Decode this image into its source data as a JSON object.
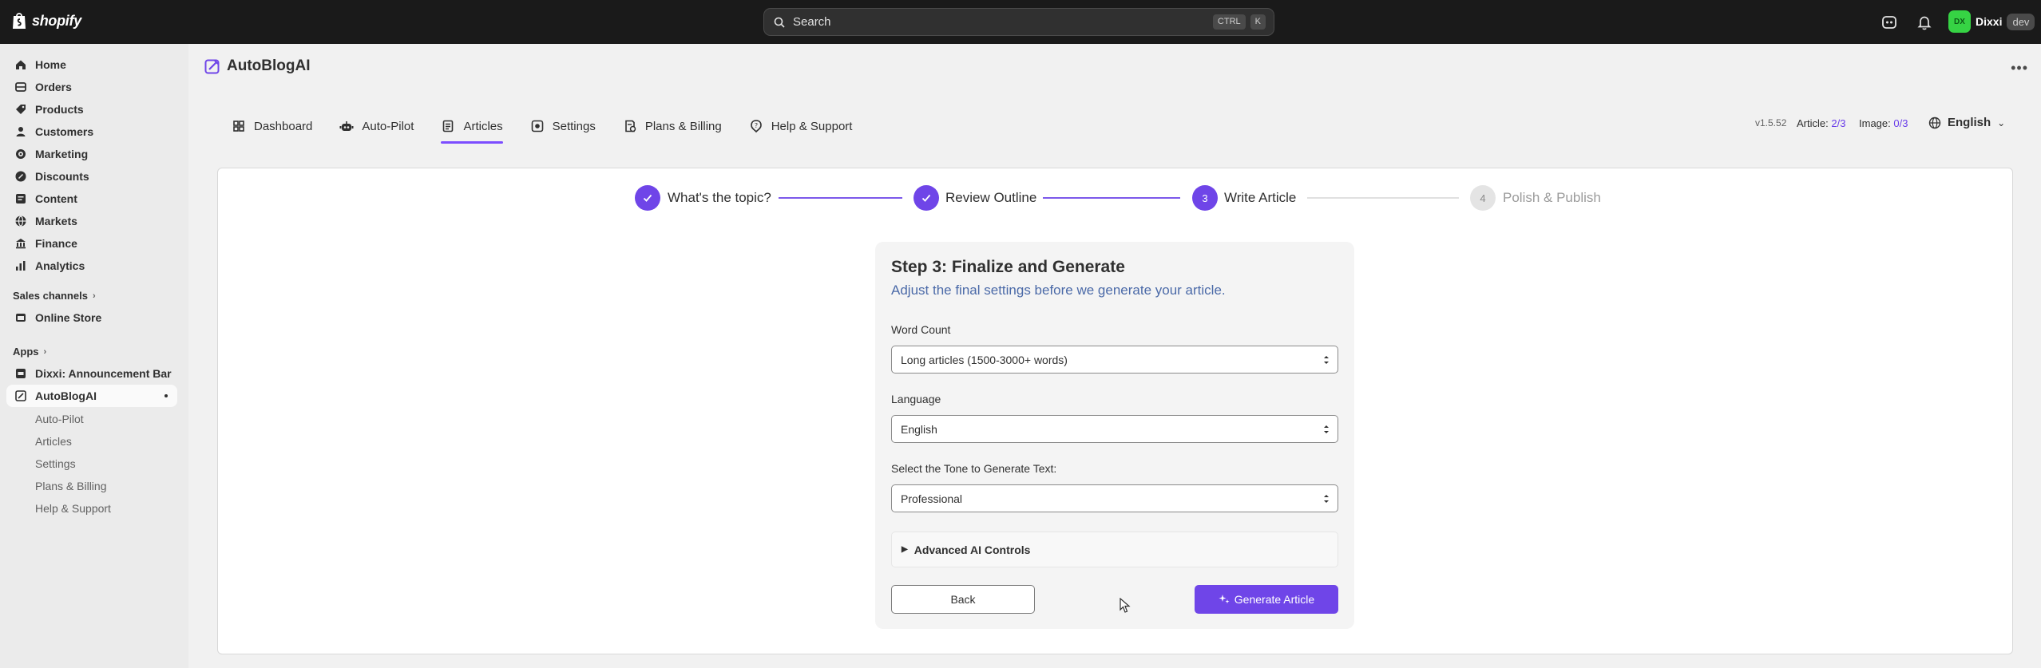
{
  "topbar": {
    "logo_text": "shopify",
    "search_label": "Search",
    "shortcut_keys": [
      "CTRL",
      "K"
    ],
    "user_initials": "DX",
    "user_name": "Dixxi",
    "env_badge": "dev"
  },
  "sidebar": {
    "nav": [
      {
        "label": "Home",
        "icon": "home-icon"
      },
      {
        "label": "Orders",
        "icon": "orders-icon"
      },
      {
        "label": "Products",
        "icon": "tag-icon"
      },
      {
        "label": "Customers",
        "icon": "person-icon"
      },
      {
        "label": "Marketing",
        "icon": "target-icon"
      },
      {
        "label": "Discounts",
        "icon": "discount-icon"
      },
      {
        "label": "Content",
        "icon": "content-icon"
      },
      {
        "label": "Markets",
        "icon": "globe-icon"
      },
      {
        "label": "Finance",
        "icon": "bank-icon"
      },
      {
        "label": "Analytics",
        "icon": "chart-icon"
      }
    ],
    "sales_channels_title": "Sales channels",
    "online_store": "Online Store",
    "apps_title": "Apps",
    "apps": [
      {
        "label": "Dixxi: Announcement Bar"
      },
      {
        "label": "AutoBlogAI"
      }
    ],
    "sub_items": [
      "Auto-Pilot",
      "Articles",
      "Settings",
      "Plans & Billing",
      "Help & Support"
    ]
  },
  "app_header": {
    "title": "AutoBlogAI"
  },
  "tabs": [
    {
      "label": "Dashboard",
      "icon": "dashboard-icon"
    },
    {
      "label": "Auto-Pilot",
      "icon": "robot-icon"
    },
    {
      "label": "Articles",
      "icon": "document-icon",
      "active": true
    },
    {
      "label": "Settings",
      "icon": "settings-icon"
    },
    {
      "label": "Plans & Billing",
      "icon": "billing-icon"
    },
    {
      "label": "Help & Support",
      "icon": "help-icon"
    }
  ],
  "meta": {
    "version": "v1.5.52",
    "article_label": "Article:",
    "article_count": "2/3",
    "image_label": "Image:",
    "image_count": "0/3",
    "language": "English"
  },
  "steps": [
    {
      "number": "1",
      "label": "What's the topic?",
      "state": "done"
    },
    {
      "number": "2",
      "label": "Review Outline",
      "state": "done"
    },
    {
      "number": "3",
      "label": "Write Article",
      "state": "current"
    },
    {
      "number": "4",
      "label": "Polish & Publish",
      "state": "todo"
    }
  ],
  "form": {
    "title": "Step 3: Finalize and Generate",
    "subtitle": "Adjust the final settings before we generate your article.",
    "word_count_label": "Word Count",
    "word_count_value": "Long articles (1500-3000+ words)",
    "language_label": "Language",
    "language_value": "English",
    "tone_label": "Select the Tone to Generate Text:",
    "tone_value": "Professional",
    "advanced_label": "Advanced AI Controls",
    "back_label": "Back",
    "generate_label": "Generate Article"
  },
  "colors": {
    "accent": "#6f45e8",
    "topbar": "#1a1a1a",
    "sidebar": "#ebebeb"
  }
}
